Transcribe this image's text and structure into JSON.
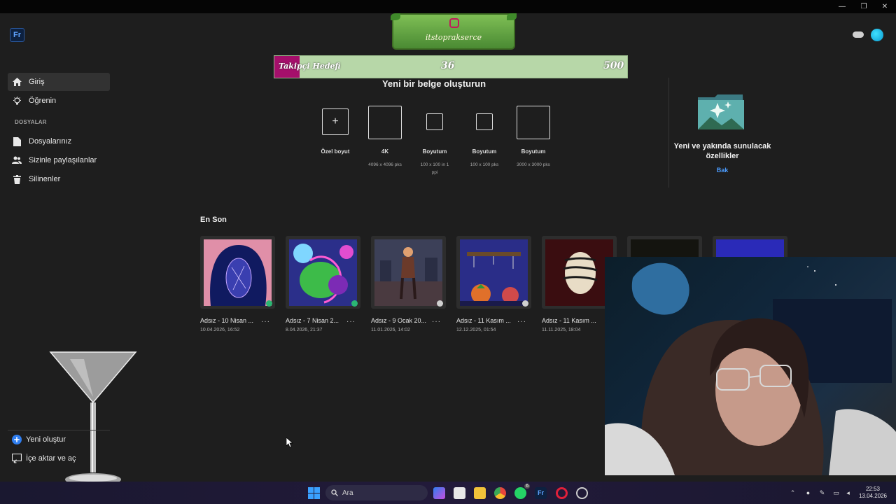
{
  "window": {
    "min_glyph": "—",
    "max_glyph": "❐",
    "close_glyph": "✕"
  },
  "app": {
    "logo_text": "Fr"
  },
  "overlay": {
    "instagram_handle": "itstoprakserce",
    "goal_label": "Takipçi Hedefi",
    "goal_current": "36",
    "goal_target": "500",
    "goal_progress": 0.072
  },
  "sidebar": {
    "items": [
      {
        "label": "Giriş",
        "icon": "home-icon",
        "active": true
      },
      {
        "label": "Öğrenin",
        "icon": "lightbulb-icon",
        "active": false
      }
    ],
    "section_label": "DOSYALAR",
    "file_items": [
      {
        "label": "Dosyalarınız",
        "icon": "file-icon"
      },
      {
        "label": "Sizinle paylaşılanlar",
        "icon": "shared-users-icon"
      },
      {
        "label": "Silinenler",
        "icon": "trash-icon"
      }
    ],
    "bottom": [
      {
        "label": "Yeni oluştur",
        "icon": "plus-circle-icon"
      },
      {
        "label": "İçe aktar ve aç",
        "icon": "import-icon"
      }
    ]
  },
  "create": {
    "title": "Yeni bir belge oluşturun",
    "presets": [
      {
        "name": "Özel boyut",
        "dims": "",
        "symbol": "+"
      },
      {
        "name": "4K",
        "dims": "4096 x 4096 pks",
        "symbol": ""
      },
      {
        "name": "Boyutum",
        "dims": "100 x 100 in 1 ppi",
        "symbol": ""
      },
      {
        "name": "Boyutum",
        "dims": "100 x 100 pks",
        "symbol": ""
      },
      {
        "name": "Boyutum",
        "dims": "3000 x 3000 pks",
        "symbol": ""
      }
    ]
  },
  "news": {
    "title": "Yeni ve yakında sunulacak özellikler",
    "link": "Bak"
  },
  "recent": {
    "title": "En Son",
    "files": [
      {
        "name": "Adsız - 10 Nisan ...",
        "date": "10.04.2026, 16:52",
        "status": "synced"
      },
      {
        "name": "Adsız - 7 Nisan 2...",
        "date": "8.04.2026, 21:37",
        "status": "synced"
      },
      {
        "name": "Adsız - 9 Ocak 20...",
        "date": "11.01.2026, 14:02",
        "status": "cloud"
      },
      {
        "name": "Adsız - 11 Kasım ...",
        "date": "12.12.2025, 01:54",
        "status": "cloud"
      },
      {
        "name": "Adsız - 11 Kasım ...",
        "date": "11.11.2025, 18:04",
        "status": "cloud"
      }
    ],
    "more_glyph": "···"
  },
  "taskbar": {
    "search_label": "Ara",
    "time": "22:53",
    "date": "13.04.2026",
    "whatsapp_badge": "6"
  }
}
